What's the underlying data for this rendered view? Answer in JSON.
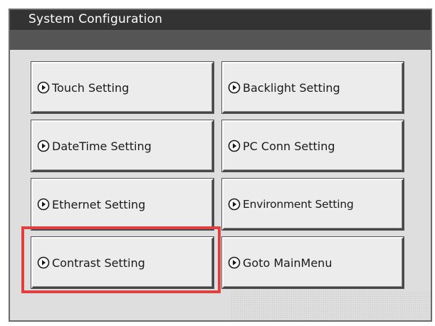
{
  "window": {
    "title": "System Configuration"
  },
  "menu": {
    "buttons": [
      {
        "label": "Touch Setting",
        "icon": "circle-arrow-right-icon",
        "highlighted": false
      },
      {
        "label": "Backlight Setting",
        "icon": "circle-arrow-right-icon",
        "highlighted": false
      },
      {
        "label": "DateTime Setting",
        "icon": "circle-arrow-right-icon",
        "highlighted": false
      },
      {
        "label": "PC Conn Setting",
        "icon": "circle-arrow-right-icon",
        "highlighted": false
      },
      {
        "label": "Ethernet Setting",
        "icon": "circle-arrow-right-icon",
        "highlighted": false
      },
      {
        "label": "Environment Setting",
        "icon": "circle-arrow-right-icon",
        "highlighted": false
      },
      {
        "label": "Contrast Setting",
        "icon": "circle-arrow-right-icon",
        "highlighted": true
      },
      {
        "label": "Goto MainMenu",
        "icon": "circle-arrow-right-icon",
        "highlighted": false
      }
    ]
  },
  "colors": {
    "title_bar": "#333333",
    "title_bar_lower": "#555555",
    "panel": "#dedede",
    "button_face": "#ececec",
    "highlight": "#e04040"
  }
}
